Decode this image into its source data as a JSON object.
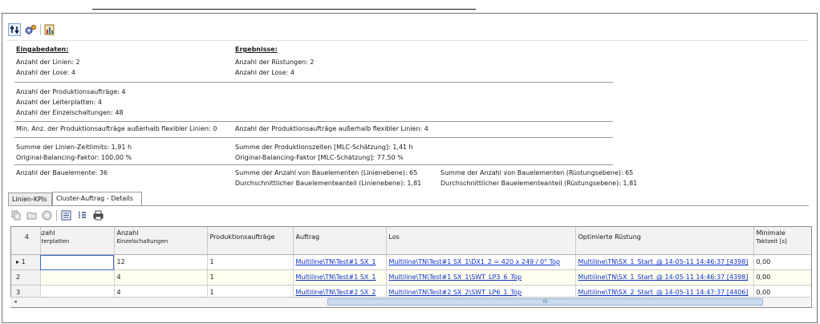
{
  "toolbar": {
    "icons": [
      "sort-arrows-icon",
      "settings-gears-icon",
      "report-chart-icon"
    ]
  },
  "summary": {
    "input_header": "Eingabedaten:",
    "result_header": "Ergebnisse:",
    "lines_count": "Anzahl der Linien:  2",
    "lots_count": "Anzahl der Lose:  4",
    "setups_count": "Anzahl der Rüstungen:  2",
    "result_lots_count": "Anzahl der Lose:  4",
    "orders_count": "Anzahl der Produktionsaufträge:  4",
    "boards_count": "Anzahl der Leiterplatten:  4",
    "circuits_count": "Anzahl der Einzelschaltungen:  48",
    "min_orders_outside": "Min. Anz. der Produktionsaufträge außerhalb flexibler Linien:  0",
    "orders_outside": "Anzahl der Produktionsaufträge außerhalb flexibler Linien:  4",
    "line_time_limits": "Summe der Linien-Zeitlimits:  1,91 h",
    "original_balancing": "Original-Balancing-Faktor:  100,00 %",
    "production_times": "Summe der Produktionszeiten [MLC-Schätzung]:  1,41 h",
    "original_balancing_mlc": "Original-Balancing-Faktor [MLC-Schätzung]:  77,50 %",
    "components_count": "Anzahl der Bauelemente:  36",
    "sum_components_line": "Summe der Anzahl von Bauelementen (Linienebene):  65",
    "avg_components_line": "Durchschnittlicher Bauelementeanteil (Linienebene):  1,81",
    "sum_components_setup": "Summe der Anzahl von Bauelementen (Rüstungsebene):  65",
    "avg_components_setup": "Durchschnittlicher Bauelementeanteil (Rüstungsebene):  1,81"
  },
  "tabs": [
    {
      "label": "Linien-KPIs",
      "active": false
    },
    {
      "label": "Cluster-Auftrag - Details",
      "active": true
    }
  ],
  "grid_toolbar": {
    "icons": [
      "copy-icon",
      "folder-icon",
      "help-circle-icon",
      "list-view-icon",
      "columns-icon",
      "print-icon"
    ]
  },
  "grid": {
    "row_count": "4",
    "columns": [
      {
        "line1": "Anzahl",
        "line2": "Leiterplatten"
      },
      {
        "line1": "Anzahl",
        "line2": "Einzelschaltungen"
      },
      {
        "line1": "Produktionsaufträge",
        "line2": ""
      },
      {
        "line1": "Auftrag",
        "line2": ""
      },
      {
        "line1": "Los",
        "line2": ""
      },
      {
        "line1": "Optimierte Rüstung",
        "line2": ""
      },
      {
        "line1": "Minimale",
        "line2": "Taktzeit [s]"
      }
    ],
    "rows": [
      {
        "num": "1",
        "boards": "",
        "circuits": "12",
        "orders": "1",
        "auftrag": "Multiline\\TN\\Test#1 SX_1",
        "los": "Multiline\\TN\\Test#1 SX_1\\DX1_2 = 420 x 249 / 0°  Top",
        "ruestung": "Multiline\\TN\\SX_1_Start_@ 14-05-11 14:46:37 [4398]",
        "takt": "0,00"
      },
      {
        "num": "2",
        "boards": "",
        "circuits": "4",
        "orders": "1",
        "auftrag": "Multiline\\TN\\Test#1 SX_1",
        "los": "Multiline\\TN\\Test#1 SX_1\\SWT_LP3_6_Top",
        "ruestung": "Multiline\\TN\\SX_1_Start_@ 14-05-11 14:46:37 [4398]",
        "takt": "0,00"
      },
      {
        "num": "3",
        "boards": "",
        "circuits": "4",
        "orders": "1",
        "auftrag": "Multiline\\TN\\Test#2 SX_2",
        "los": "Multiline\\TN\\Test#2 SX_2\\SWT_LP6_1_Top",
        "ruestung": "Multiline\\TN\\SX_2_Start_@ 14-05-11 14:47:37 [4406]",
        "takt": "0,00"
      }
    ]
  },
  "scrollbar": {
    "grip": "III"
  }
}
